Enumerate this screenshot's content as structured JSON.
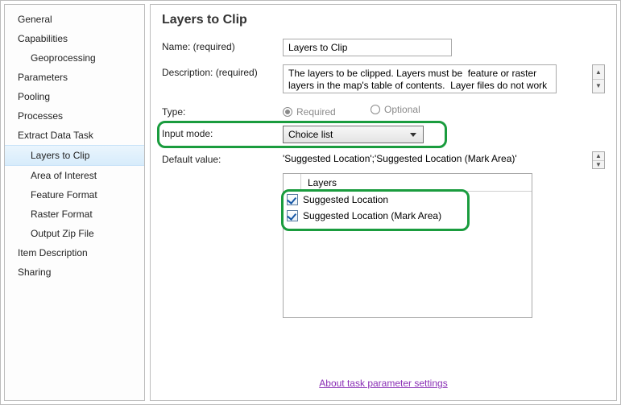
{
  "sidebar": {
    "items": [
      {
        "label": "General"
      },
      {
        "label": "Capabilities"
      },
      {
        "label": "Geoprocessing",
        "sub": true
      },
      {
        "label": "Parameters"
      },
      {
        "label": "Pooling"
      },
      {
        "label": "Processes"
      },
      {
        "label": "Extract Data Task"
      },
      {
        "label": "Layers to Clip",
        "sub": true,
        "selected": true
      },
      {
        "label": "Area of Interest",
        "sub": true
      },
      {
        "label": "Feature Format",
        "sub": true
      },
      {
        "label": "Raster Format",
        "sub": true
      },
      {
        "label": "Output Zip File",
        "sub": true
      },
      {
        "label": "Item Description"
      },
      {
        "label": "Sharing"
      }
    ]
  },
  "panel": {
    "title": "Layers to Clip",
    "name_label": "Name:  (required)",
    "name_value": "Layers to Clip",
    "desc_label": "Description:  (required)",
    "desc_value": "The layers to be clipped. Layers must be  feature or raster layers in the map's table of contents.  Layer files do not work",
    "type_label": "Type:",
    "type_options": {
      "required": "Required",
      "optional": "Optional"
    },
    "input_mode_label": "Input mode:",
    "input_mode_value": "Choice list",
    "default_label": "Default value:",
    "default_value": "'Suggested Location';'Suggested Location (Mark Area)'",
    "layers_header": "Layers",
    "layers": [
      {
        "label": "Suggested Location",
        "checked": true
      },
      {
        "label": "Suggested Location (Mark Area)",
        "checked": true
      }
    ],
    "footer_link": "About task parameter settings"
  }
}
